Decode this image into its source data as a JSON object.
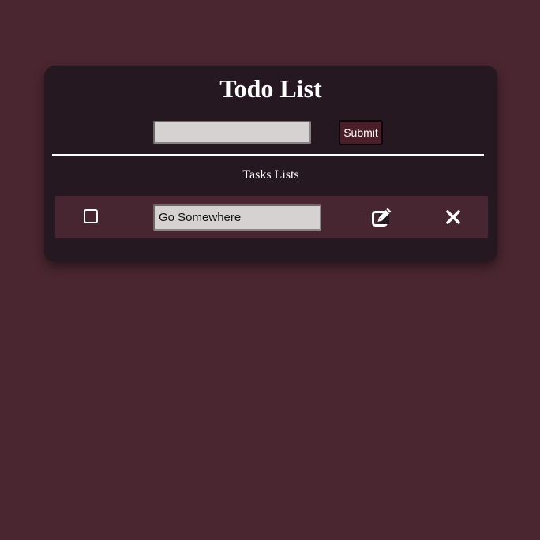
{
  "app": {
    "title": "Todo List"
  },
  "new_task": {
    "value": "",
    "placeholder": "",
    "submit_label": "Submit"
  },
  "tasks_section": {
    "heading": "Tasks Lists",
    "items": [
      {
        "text": "Go Somewhere",
        "completed": false,
        "edit_icon": "edit-icon",
        "delete_icon": "close-icon"
      }
    ]
  },
  "colors": {
    "page_background": "#4a2630",
    "card_background": "#251820",
    "task_row_background": "#472631",
    "submit_background": "#4a1e28",
    "input_background": "#d6d2d2",
    "text": "#ffffff"
  }
}
